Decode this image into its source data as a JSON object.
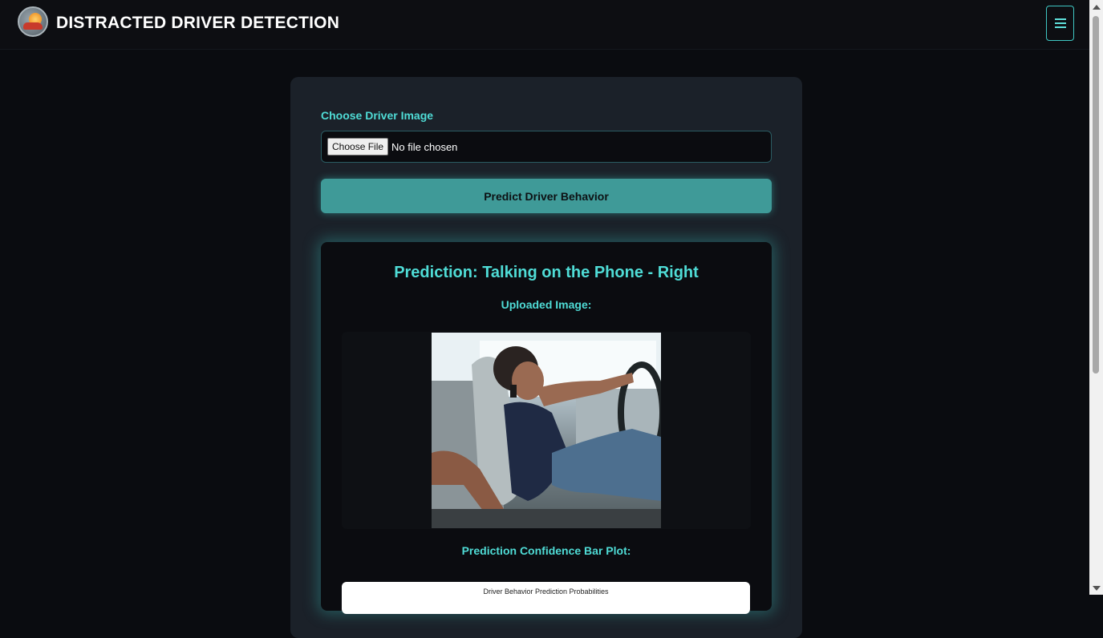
{
  "header": {
    "title": "DISTRACTED DRIVER DETECTION",
    "menu_icon": "hamburger-menu-icon"
  },
  "form": {
    "choose_label": "Choose Driver Image",
    "file_button_label": "Choose File",
    "file_status": "No file chosen",
    "predict_button_label": "Predict Driver Behavior"
  },
  "result": {
    "prediction_title": "Prediction: Talking on the Phone - Right",
    "uploaded_image_label": "Uploaded Image:",
    "bar_plot_label": "Prediction Confidence Bar Plot:",
    "plot_title": "Driver Behavior Prediction Probabilities"
  },
  "colors": {
    "accent": "#4fdcd6",
    "button": "#3f9a98",
    "card": "#1b2129",
    "background": "#0a0c10"
  }
}
